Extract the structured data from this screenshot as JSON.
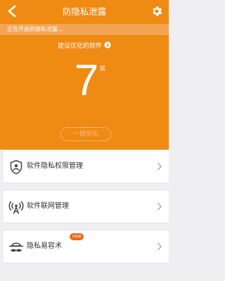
{
  "header": {
    "title": "防隐私泄露",
    "back_icon": "chevron-left-icon",
    "settings_icon": "gear-icon",
    "bg_color": "#ef8a13"
  },
  "status": {
    "text": "正在开启防隐私泄露..."
  },
  "summary": {
    "suggest_label": "建议优化的软件",
    "count": "7",
    "unit": "款",
    "optimize_label": "一键优化"
  },
  "menu": [
    {
      "label": "软件隐私权限管理",
      "icon": "shield-user-icon"
    },
    {
      "label": "软件联网管理",
      "icon": "network-antenna-icon"
    },
    {
      "label": "隐私易容术",
      "icon": "disguise-hat-mustache-icon",
      "badge": "new"
    }
  ]
}
